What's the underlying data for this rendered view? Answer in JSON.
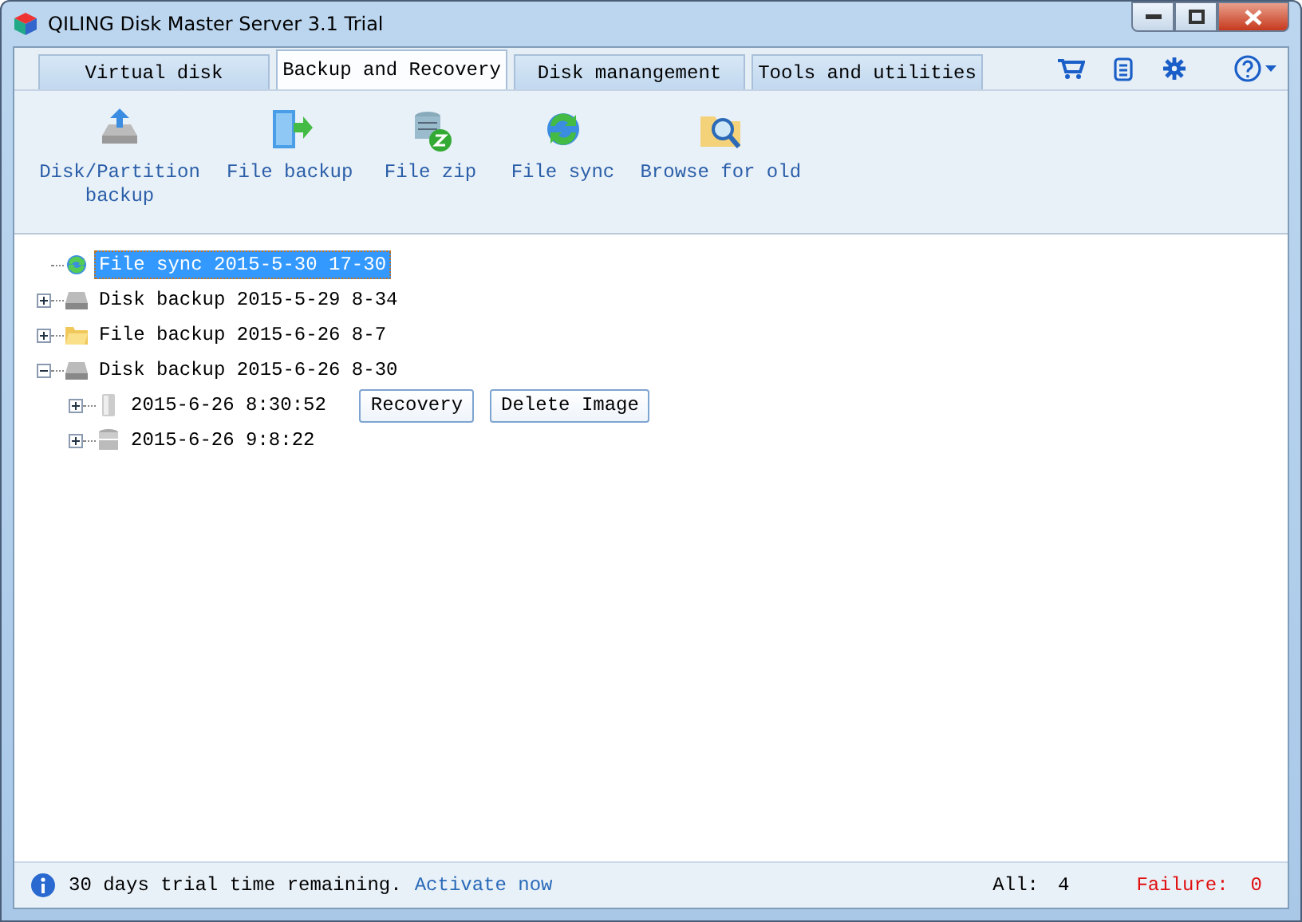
{
  "window": {
    "title": "QILING Disk Master Server 3.1 Trial"
  },
  "tabs": [
    {
      "label": "Virtual disk",
      "selected": false
    },
    {
      "label": "Backup and Recovery",
      "selected": true
    },
    {
      "label": "Disk manangement",
      "selected": false
    },
    {
      "label": "Tools and utilities",
      "selected": false
    }
  ],
  "toolbar": [
    {
      "label": "Disk/Partition backup",
      "kind": "disk"
    },
    {
      "label": "File backup",
      "kind": "file"
    },
    {
      "label": "File zip",
      "kind": "zip"
    },
    {
      "label": "File sync",
      "kind": "sync"
    },
    {
      "label": "Browse for old",
      "kind": "browse"
    }
  ],
  "tree": [
    {
      "label": "File sync 2015-5-30 17-30",
      "kind": "sync",
      "selected": true
    },
    {
      "label": "Disk backup 2015-5-29 8-34",
      "kind": "disk",
      "selected": false,
      "expanded": false
    },
    {
      "label": "File backup 2015-6-26 8-7",
      "kind": "folder",
      "selected": false,
      "expanded": false
    },
    {
      "label": "Disk backup 2015-6-26 8-30",
      "kind": "disk",
      "selected": false,
      "expanded": true,
      "children": [
        {
          "label": "2015-6-26 8:30:52",
          "kind": "image",
          "selected": false,
          "expanded": false,
          "actions": [
            "Recovery",
            "Delete Image"
          ]
        },
        {
          "label": "2015-6-26 9:8:22",
          "kind": "stack",
          "selected": false,
          "expanded": false
        }
      ]
    }
  ],
  "status_bar": {
    "message": "30 days trial time remaining.",
    "link": "Activate now",
    "all_label": "All:",
    "all_count": "4",
    "failure_label": "Failure:",
    "failure_count": "0"
  }
}
